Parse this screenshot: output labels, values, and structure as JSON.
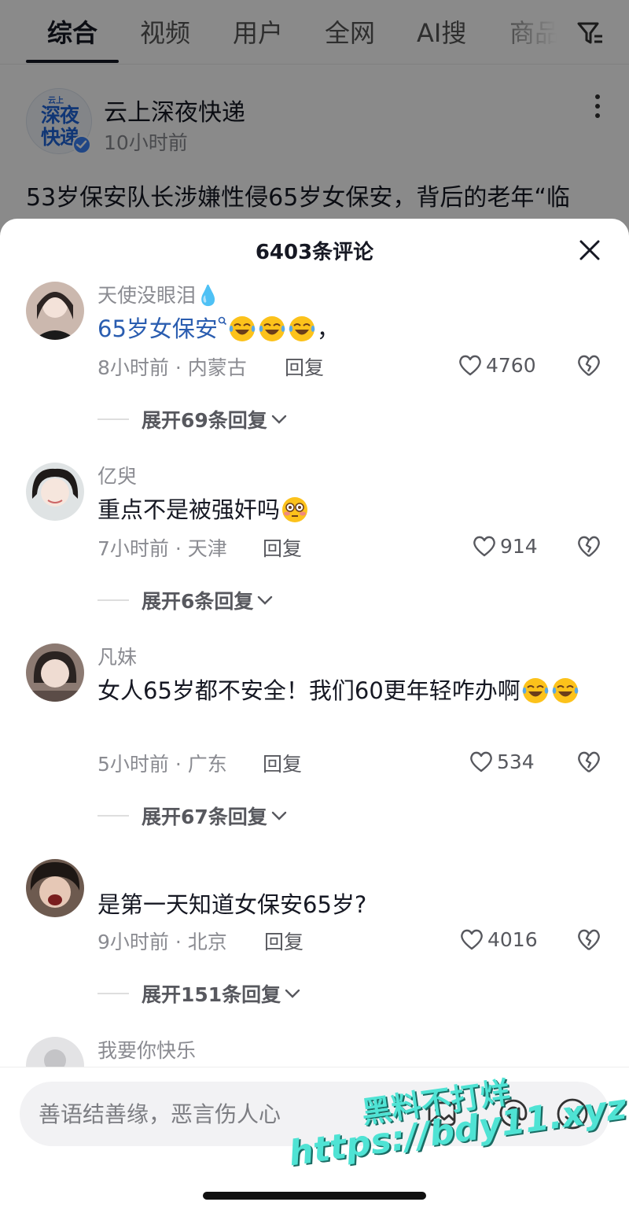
{
  "tabs": [
    "综合",
    "视频",
    "用户",
    "全网",
    "AI搜",
    "商品"
  ],
  "post": {
    "avatar_tag": "云上",
    "avatar_text": "深夜快递",
    "author": "云上深夜快递",
    "time": "10小时前",
    "headline": "53岁保安队长涉嫌性侵65岁女保安，背后的老年“临"
  },
  "sheet": {
    "title": "6403条评论"
  },
  "comments": [
    {
      "name": "天使没眼泪💧",
      "text_link": "65岁女保安",
      "text_suffix": "，",
      "time_location": "8小时前 · 内蒙古",
      "reply_label": "回复",
      "likes": "4760",
      "expand_label": "展开69条回复",
      "avatar_color": "#e9d7cf"
    },
    {
      "name": "亿臾",
      "text": "重点不是被强奸吗",
      "time_location": "7小时前 · 天津",
      "reply_label": "回复",
      "likes": "914",
      "expand_label": "展开6条回复",
      "avatar_color": "#e4d6d2"
    },
    {
      "name": "凡妹",
      "text": "女人65岁都不安全！我们60更年轻咋办啊",
      "time_location": "5小时前 · 广东",
      "reply_label": "回复",
      "likes": "534",
      "expand_label": "展开67条回复",
      "avatar_color": "#c9b6ad"
    },
    {
      "name": "",
      "text": "是第一天知道女保安65岁?",
      "time_location": "9小时前 · 北京",
      "reply_label": "回复",
      "likes": "4016",
      "expand_label": "展开151条回复",
      "avatar_color": "#b39a8a"
    },
    {
      "name": "我要你快乐",
      "avatar_color": "#d7d7d9"
    }
  ],
  "input": {
    "placeholder": "善语结善缘，恶言伤人心"
  },
  "watermark": {
    "line1": "黑料不打烊",
    "line2": "https://bdy11.xyz"
  },
  "colors": {
    "link": "#2a5db0",
    "verified": "#3b82f6",
    "watermark": "#4fe3d4"
  }
}
